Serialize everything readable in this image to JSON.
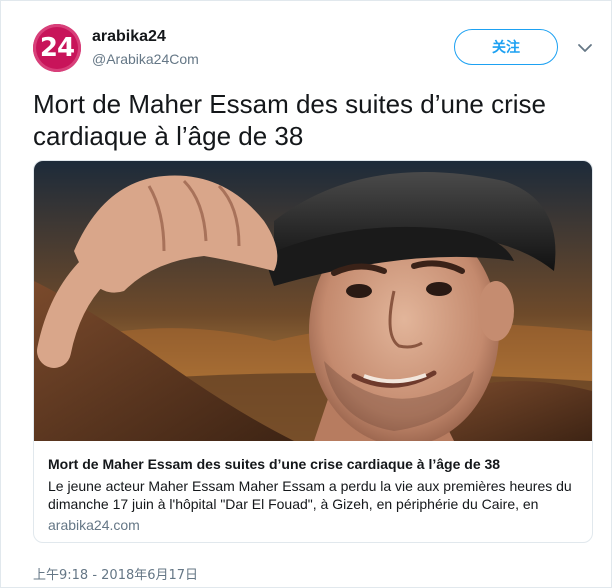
{
  "author": {
    "avatar_text": "24",
    "display_name": "arabika24",
    "handle": "@Arabika24Com"
  },
  "actions": {
    "follow_label": "关注"
  },
  "tweet": {
    "text": "Mort de Maher Essam des suites d’une crise cardiaque à l’âge de 38",
    "timestamp": "上午9:18 - 2018年6月17日"
  },
  "card": {
    "title": "Mort de Maher Essam des suites d’une crise cardiaque à l’âge de 38",
    "description": "Le jeune acteur Maher Essam Maher Essam a perdu la vie aux premières heures du dimanche 17 juin à l'hôpital \"Dar El Fouad\", à Gizeh, en périphérie du Caire, en",
    "domain": "arabika24.com"
  },
  "colors": {
    "accent": "#1da1f2",
    "avatar_bg": "#c8145a",
    "secondary_text": "#657786",
    "border": "#e1e8ed"
  },
  "icons": {
    "menu": "chevron-down-icon"
  }
}
